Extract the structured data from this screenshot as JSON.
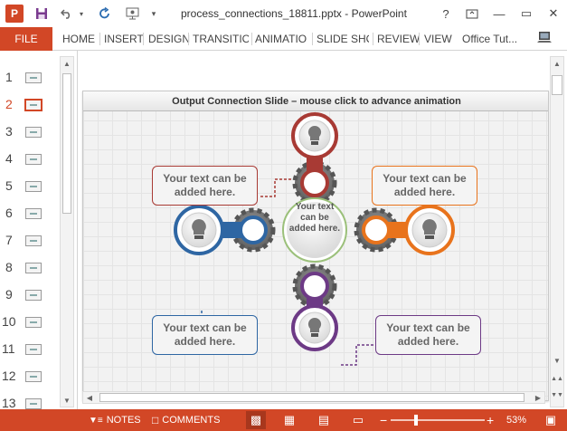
{
  "window": {
    "title": "process_connections_18811.pptx - PowerPoint",
    "help_icon": "?",
    "minimize": "—",
    "restore": "▭",
    "close": "✕"
  },
  "quick_access": {
    "app_logo": "P",
    "save_icon": "save-icon",
    "undo_icon": "undo-icon",
    "redo_icon": "redo-icon",
    "present_icon": "start-from-beginning-icon",
    "customize_icon": "customize-icon"
  },
  "ribbon": {
    "file": "FILE",
    "tabs": [
      "HOME",
      "INSERT",
      "DESIGN",
      "TRANSITIO",
      "ANIMATIO",
      "SLIDE SHO",
      "REVIEW",
      "VIEW"
    ],
    "account": "Office Tut..."
  },
  "thumbnails": {
    "numbers": [
      "1",
      "2",
      "3",
      "4",
      "5",
      "6",
      "7",
      "8",
      "9",
      "10",
      "11",
      "12",
      "13"
    ],
    "active_index": 2
  },
  "slide": {
    "header": "Output Connection Slide – mouse click to advance animation",
    "center_text": "Your text can be added here.",
    "box_top_left": "Your text can be added here.",
    "box_top_right": "Your text can be added here.",
    "box_bottom_left": "Your text can be added here.",
    "box_bottom_right": "Your text can be added here.",
    "colors": {
      "top": "#a83a34",
      "right": "#e8731c",
      "bottom": "#6d3a86",
      "left": "#2e66a3",
      "gear": "#7a7a7a"
    }
  },
  "statusbar": {
    "notes": "NOTES",
    "comments": "COMMENTS",
    "zoom_out": "−",
    "zoom_in": "+",
    "zoom": "53%",
    "zoom_fraction": 0.53,
    "color": "#d24726"
  }
}
